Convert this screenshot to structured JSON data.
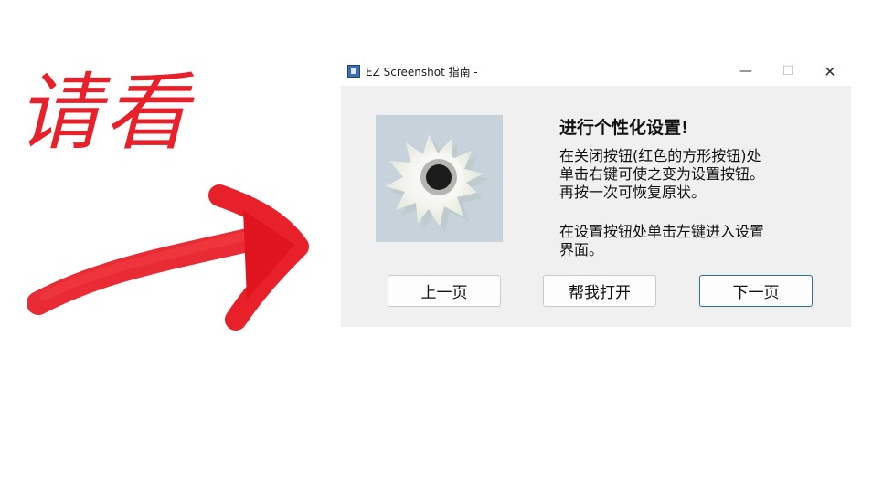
{
  "annotation": {
    "text": "请看"
  },
  "window": {
    "title": "EZ Screenshot 指南  -",
    "controls": {
      "minimize": "—",
      "maximize": "☐",
      "close": "✕"
    }
  },
  "guide": {
    "heading": "进行个性化设置!",
    "paragraph1": "在关闭按钮(红色的方形按钮)处\n单击右键可使之变为设置按钮。\n再按一次可恢复原状。",
    "paragraph2": "在设置按钮处单击左键进入设置\n界面。"
  },
  "buttons": {
    "prev": "上一页",
    "open": "帮我打开",
    "next": "下一页"
  },
  "colors": {
    "annotation": "#e8202a",
    "client_bg": "#f0f0f0",
    "gear_bg": "#c7d2da",
    "focus_border": "#2f6f9a"
  }
}
